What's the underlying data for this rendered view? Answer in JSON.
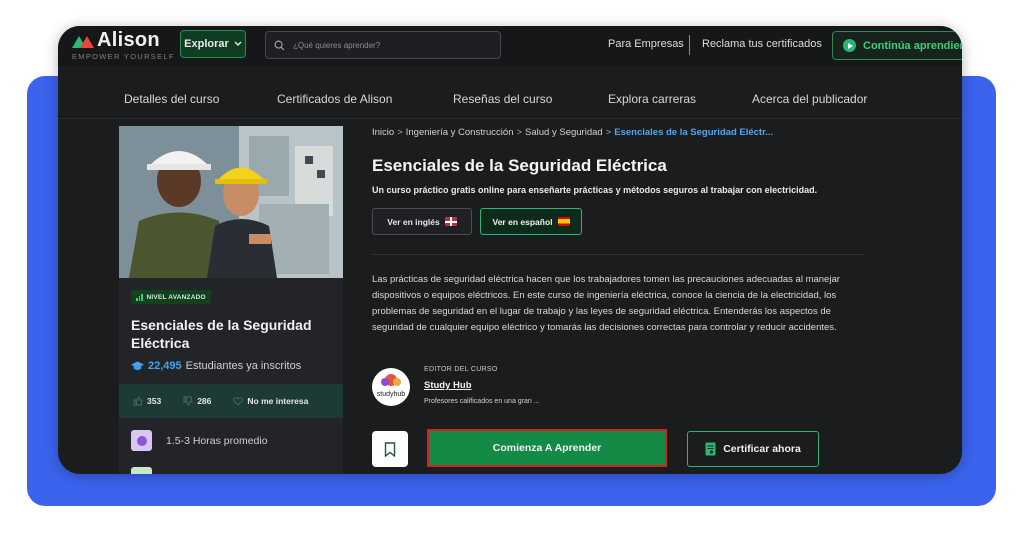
{
  "header": {
    "logo_text": "Alison",
    "logo_tagline": "EMPOWER YOURSELF",
    "explore_label": "Explorar",
    "search_placeholder": "¿Qué quieres aprender?",
    "business_link": "Para Empresas",
    "certificates_link": "Reclama tus certificados",
    "continue_label": "Continúa aprendiendo"
  },
  "course_nav": {
    "items": [
      {
        "label": "Detalles del curso"
      },
      {
        "label": "Certificados de Alison"
      },
      {
        "label": "Reseñas del curso"
      },
      {
        "label": "Explora carreras"
      },
      {
        "label": "Acerca del publicador"
      }
    ]
  },
  "left_card": {
    "level": "NIVEL AVANZADO",
    "title": "Esenciales de la Seguridad Eléctrica",
    "enrolled_count": "22,495",
    "enrolled_label": "Estudiantes ya inscritos",
    "likes": "353",
    "dislikes": "286",
    "not_interested": "No me interesa",
    "duration": "1.5-3 Horas promedio"
  },
  "breadcrumb": {
    "items": [
      "Inicio",
      "Ingeniería y Construcción",
      "Salud y Seguridad"
    ],
    "current": "Esenciales de la Seguridad Eléctr..."
  },
  "course": {
    "title": "Esenciales de la Seguridad Eléctrica",
    "subtitle": "Un curso práctico gratis online para enseñarte prácticas y métodos seguros al trabajar con electricidad.",
    "lang_en": "Ver en inglés",
    "lang_es": "Ver en español",
    "description": "Las prácticas de seguridad eléctrica hacen que los trabajadores tomen las precauciones adecuadas al manejar dispositivos o equipos eléctricos. En este curso de ingeniería eléctrica, conoce la ciencia de la electricidad, los problemas de seguridad en el lugar de trabajo y las leyes de seguridad eléctrica. Entenderás los aspectos de seguridad de cualquier equipo eléctrico y tomarás las decisiones correctas para controlar y reducir accidentes."
  },
  "publisher": {
    "label": "EDITOR DEL CURSO",
    "name": "Study Hub",
    "description": "Profesores calificados en una gran ...",
    "avatar_text": "studyhub"
  },
  "actions": {
    "start_label": "Comienza A Aprender",
    "certify_label": "Certificar ahora"
  },
  "colors": {
    "brand_green": "#138a46",
    "accent_blue": "#3b63ee",
    "link_blue": "#4aa8f5"
  }
}
